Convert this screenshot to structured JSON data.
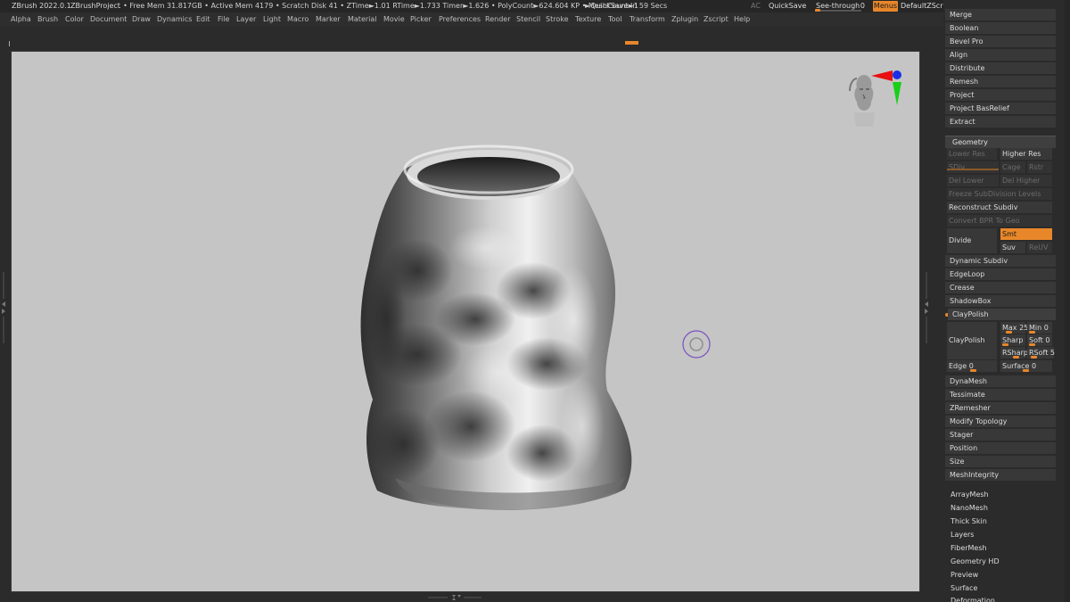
{
  "titlebar": {
    "app_version": "ZBrush 2022.0.1",
    "project": "ZBrushProject",
    "status": ". • Free Mem 31.817GB • Active Mem 4179 • Scratch Disk 41 • ZTime►1.01 RTime►1.733 Timer►1.626 • PolyCount►624.604 KP • MeshCount►1",
    "quicksave_timer": "►QuickSave In 59 Secs",
    "ac_label": "AC",
    "quicksave_label": "QuickSave",
    "seethrough_label": "See-through",
    "seethrough_value": "0",
    "seethrough_level": 0,
    "menus_label": "Menus",
    "script_label": "DefaultZScript"
  },
  "menubar": {
    "items": [
      "Alpha",
      "Brush",
      "Color",
      "Document",
      "Draw",
      "Dynamics",
      "Edit",
      "File",
      "Layer",
      "Light",
      "Macro",
      "Marker",
      "Material",
      "Movie",
      "Picker",
      "Preferences",
      "Render",
      "Stencil",
      "Stroke",
      "Texture",
      "Tool",
      "Transform",
      "Zplugin",
      "Zscript",
      "Help"
    ]
  },
  "subtool_menu": {
    "items": [
      "Merge",
      "Boolean",
      "Bevel Pro",
      "Align",
      "Distribute",
      "Remesh",
      "Project",
      "Project BasRelief",
      "Extract"
    ]
  },
  "geometry": {
    "header": "Geometry",
    "lower_res": "Lower Res",
    "higher_res": "Higher Res",
    "sdiv": "SDiv",
    "cage": "Cage",
    "rstr": "Rstr",
    "del_lower": "Del Lower",
    "del_higher": "Del Higher",
    "freeze_subdiv": "Freeze SubDivision Levels",
    "reconstruct": "Reconstruct Subdiv",
    "convert_bpr": "Convert BPR To Geo",
    "divide": "Divide",
    "smt": "Smt",
    "suv": "Suv",
    "reuv": "ReUV",
    "dynamic_subdiv": "Dynamic Subdiv",
    "edgeloop": "EdgeLoop",
    "crease": "Crease",
    "shadowbox": "ShadowBox",
    "claypolish_header": "ClayPolish",
    "claypolish_btn": "ClayPolish",
    "max_label": "Max",
    "max_value": "25",
    "min_label": "Min",
    "min_value": "0",
    "sharp_label": "Sharp",
    "soft_label": "Soft",
    "soft_value": "0",
    "rsharp_label": "RSharp",
    "rsoft_label": "RSoft",
    "rsoft_value": "5",
    "edge_label": "Edge",
    "edge_value": "0",
    "surface_label": "Surface",
    "surface_value": "0",
    "after_items": [
      "DynaMesh",
      "Tessimate",
      "ZRemesher",
      "Modify Topology",
      "Stager",
      "Position",
      "Size",
      "MeshIntegrity"
    ]
  },
  "tool_subpalettes": {
    "items": [
      "ArrayMesh",
      "NanoMesh",
      "Thick Skin",
      "Layers",
      "FiberMesh",
      "Geometry HD",
      "Preview",
      "Surface",
      "Deformation"
    ]
  },
  "colors": {
    "accent": "#e8872a",
    "canvas": "#c5c5c5",
    "panel": "#2b2b2b",
    "cursor_ring": "#7a4fc0"
  },
  "icons": {
    "navigation_head": "head-icon",
    "gyro": "axis-gizmo-icon",
    "brush_cursor": "brush-cursor-icon"
  }
}
